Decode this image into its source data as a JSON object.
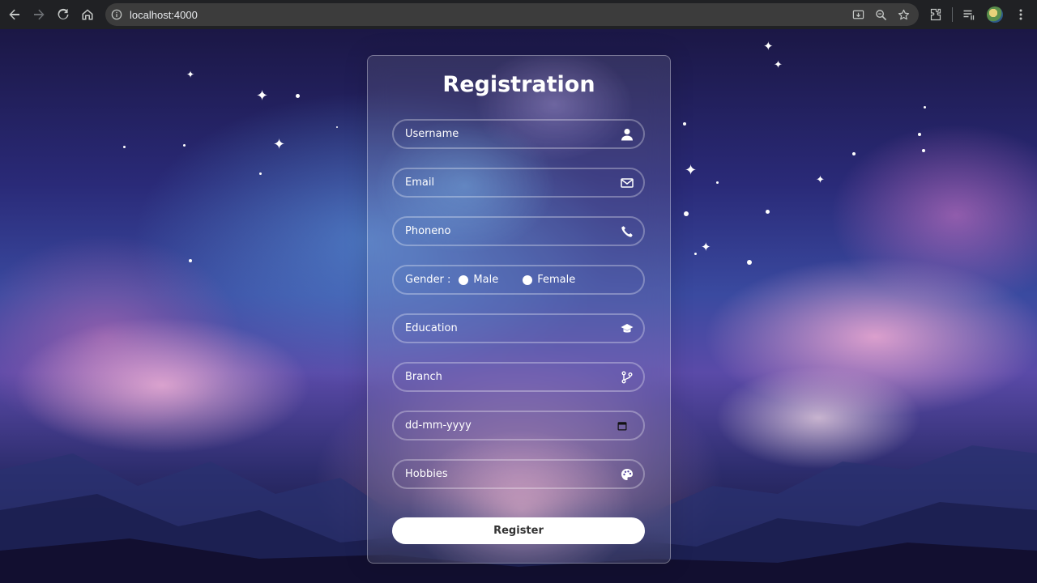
{
  "browser": {
    "url": "localhost:4000"
  },
  "form": {
    "title": "Registration",
    "username_placeholder": "Username",
    "email_placeholder": "Email",
    "phone_placeholder": "Phoneno",
    "gender_label": "Gender :",
    "gender_options": [
      "Male",
      "Female"
    ],
    "education_placeholder": "Education",
    "branch_placeholder": "Branch",
    "date_placeholder": "dd-mm-yyyy",
    "hobbies_placeholder": "Hobbies",
    "register_label": "Register"
  },
  "icons": {
    "username": "user-icon",
    "email": "envelope-icon",
    "phone": "phone-icon",
    "education": "graduation-cap-icon",
    "branch": "code-branch-icon",
    "date": "calendar-icon",
    "hobbies": "palette-icon"
  },
  "colors": {
    "chrome_bg": "#202124",
    "address_bar_bg": "#3c3c3c",
    "button_bg": "#ffffff",
    "text": "#ffffff"
  }
}
